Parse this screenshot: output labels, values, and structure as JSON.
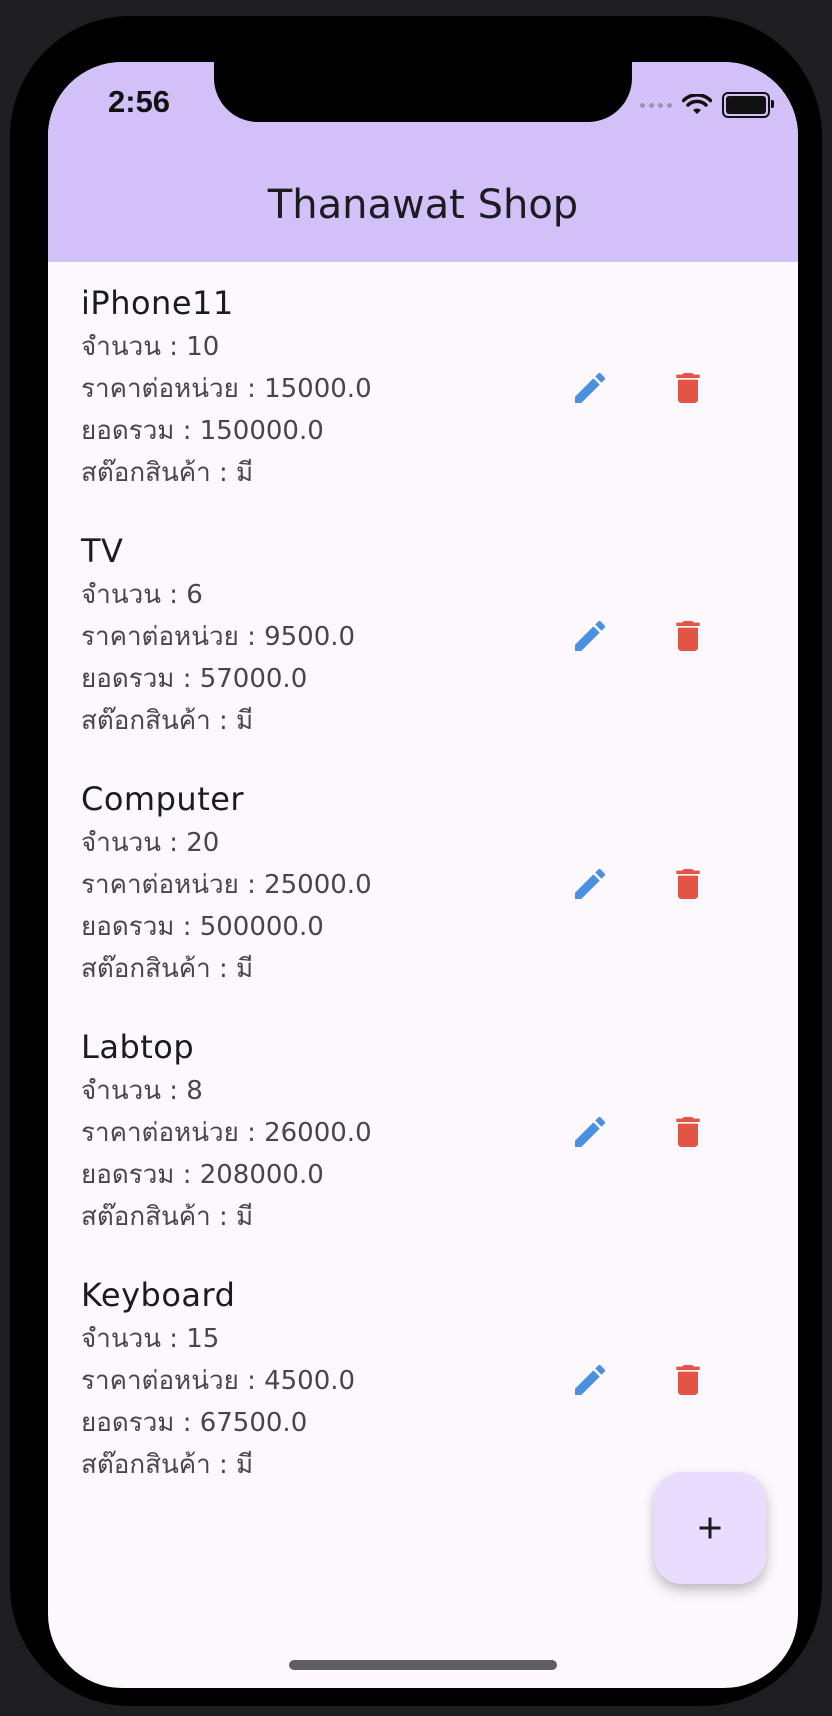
{
  "status_bar": {
    "time": "2:56"
  },
  "appbar": {
    "title": "Thanawat Shop"
  },
  "colors": {
    "appbar": "#d2c1f8",
    "edit_icon": "#4a90e2",
    "delete_icon": "#e25545",
    "fab": "#e9ddff"
  },
  "products": [
    {
      "name": "iPhone11",
      "quantity": "จำนวน : 10",
      "unit_price": "ราคาต่อหน่วย : 15000.0",
      "total": "ยอดรวม : 150000.0",
      "stock": "สต๊อกสินค้า : มี"
    },
    {
      "name": "TV",
      "quantity": "จำนวน : 6",
      "unit_price": "ราคาต่อหน่วย : 9500.0",
      "total": "ยอดรวม : 57000.0",
      "stock": "สต๊อกสินค้า : มี"
    },
    {
      "name": "Computer",
      "quantity": "จำนวน : 20",
      "unit_price": "ราคาต่อหน่วย : 25000.0",
      "total": "ยอดรวม : 500000.0",
      "stock": "สต๊อกสินค้า : มี"
    },
    {
      "name": "Labtop",
      "quantity": "จำนวน : 8",
      "unit_price": "ราคาต่อหน่วย : 26000.0",
      "total": "ยอดรวม : 208000.0",
      "stock": "สต๊อกสินค้า : มี"
    },
    {
      "name": "Keyboard",
      "quantity": "จำนวน : 15",
      "unit_price": "ราคาต่อหน่วย : 4500.0",
      "total": "ยอดรวม : 67500.0",
      "stock": "สต๊อกสินค้า : มี"
    }
  ],
  "fab": {
    "icon": "plus-icon"
  }
}
